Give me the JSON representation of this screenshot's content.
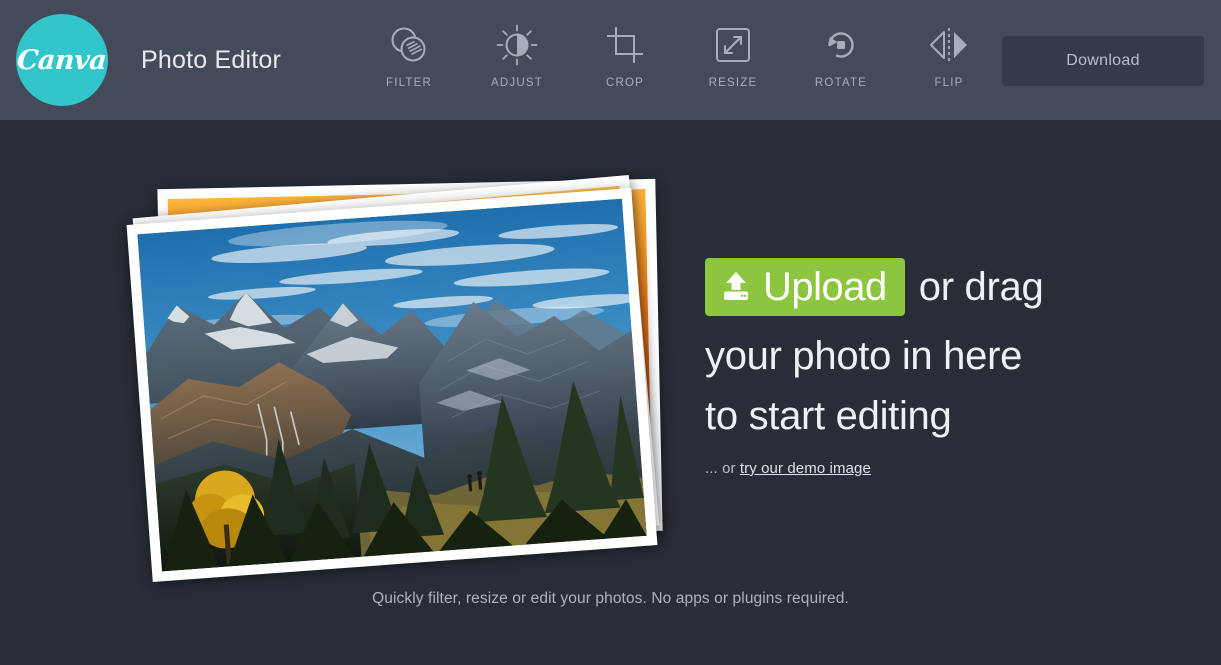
{
  "header": {
    "logo_text": "Canva",
    "logo_icon": "canva-logo-icon",
    "app_title": "Photo Editor",
    "logo_color": "#33c5cc",
    "bar_color": "#434a5a",
    "tools": [
      {
        "label": "FILTER",
        "icon": "filter-circles-icon"
      },
      {
        "label": "ADJUST",
        "icon": "brightness-sun-icon"
      },
      {
        "label": "CROP",
        "icon": "crop-marks-icon"
      },
      {
        "label": "RESIZE",
        "icon": "resize-diagonal-arrow-icon"
      },
      {
        "label": "ROTATE",
        "icon": "rotate-counterclockwise-icon"
      },
      {
        "label": "FLIP",
        "icon": "flip-horizontal-icon"
      }
    ],
    "download_label": "Download"
  },
  "main": {
    "upload_label": "Upload",
    "upload_icon": "upload-arrow-icon",
    "upload_color": "#8cc63e",
    "headline_after_button": "or drag",
    "headline_line2": "your photo in here",
    "headline_line3": "to start editing",
    "demo_prefix": "... or ",
    "demo_link": "try our demo image",
    "footer_note": "Quickly filter, resize or edit your photos. No apps or plugins required.",
    "photo_stack": {
      "back_photo_label": "sunset-photo",
      "front_photo_label": "mountain-landscape-photo"
    }
  },
  "background_color": "#282d38"
}
